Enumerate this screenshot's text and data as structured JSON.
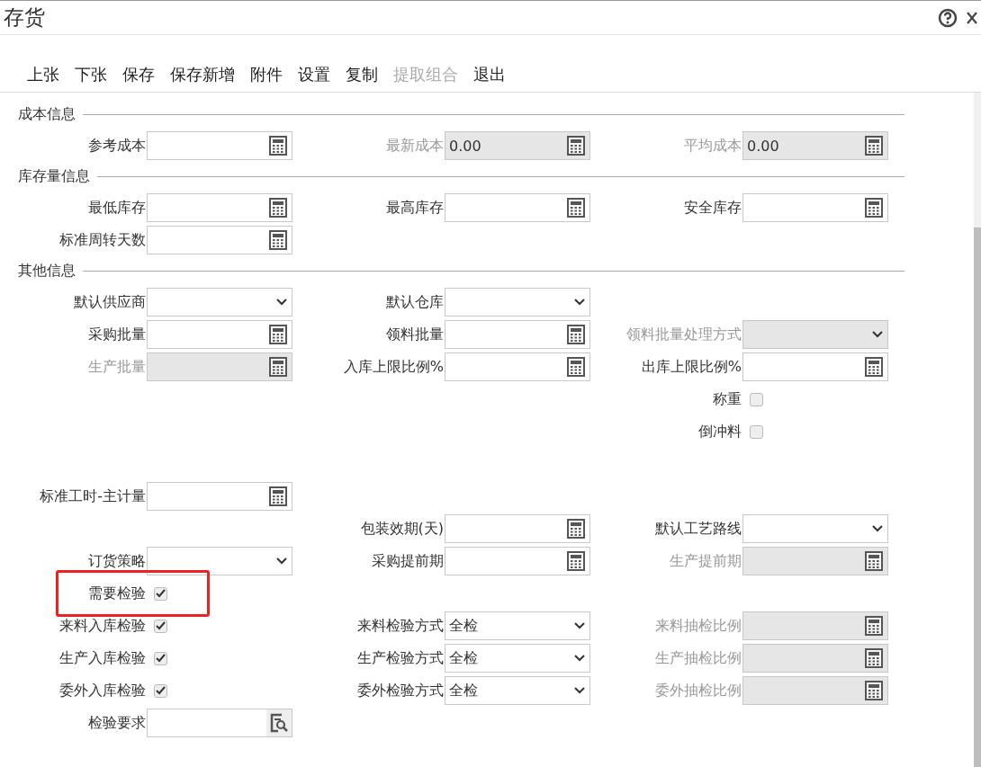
{
  "window": {
    "title": "存货"
  },
  "toolbar": [
    {
      "label": "上张",
      "disabled": false
    },
    {
      "label": "下张",
      "disabled": false
    },
    {
      "label": "保存",
      "disabled": false
    },
    {
      "label": "保存新增",
      "disabled": false
    },
    {
      "label": "附件",
      "disabled": false
    },
    {
      "label": "设置",
      "disabled": false
    },
    {
      "label": "复制",
      "disabled": false
    },
    {
      "label": "提取组合",
      "disabled": true
    },
    {
      "label": "退出",
      "disabled": false
    }
  ],
  "form": [
    {
      "kind": "section",
      "title": "成本信息"
    },
    {
      "kind": "fields",
      "cells": [
        {
          "kind": "calc",
          "label": "参考成本",
          "disabled": false
        },
        {
          "kind": "calc",
          "label": "最新成本",
          "value": "0.00",
          "disabled": true
        },
        {
          "kind": "calc",
          "label": "平均成本",
          "value": "0.00",
          "disabled": true
        }
      ]
    },
    {
      "kind": "section",
      "title": "库存量信息"
    },
    {
      "kind": "fields",
      "cells": [
        {
          "kind": "calc",
          "label": "最低库存",
          "disabled": false
        },
        {
          "kind": "calc",
          "label": "最高库存",
          "disabled": false
        },
        {
          "kind": "calc",
          "label": "安全库存",
          "disabled": false
        }
      ]
    },
    {
      "kind": "fields",
      "cells": [
        {
          "kind": "calc",
          "label": "标准周转天数",
          "disabled": false
        },
        {
          "kind": "empty"
        },
        {
          "kind": "empty"
        }
      ]
    },
    {
      "kind": "section",
      "title": "其他信息"
    },
    {
      "kind": "fields",
      "cells": [
        {
          "kind": "select",
          "label": "默认供应商",
          "disabled": false
        },
        {
          "kind": "select",
          "label": "默认仓库",
          "disabled": false
        },
        {
          "kind": "empty"
        }
      ]
    },
    {
      "kind": "fields",
      "cells": [
        {
          "kind": "calc",
          "label": "采购批量",
          "disabled": false
        },
        {
          "kind": "calc",
          "label": "领料批量",
          "disabled": false
        },
        {
          "kind": "select",
          "label": "领料批量处理方式",
          "disabled": true
        }
      ]
    },
    {
      "kind": "fields",
      "cells": [
        {
          "kind": "calc",
          "label": "生产批量",
          "disabled": true
        },
        {
          "kind": "calc",
          "label": "入库上限比例%",
          "disabled": false
        },
        {
          "kind": "calc",
          "label": "出库上限比例%",
          "disabled": false
        }
      ]
    },
    {
      "kind": "fields",
      "cells": [
        {
          "kind": "empty"
        },
        {
          "kind": "empty"
        },
        {
          "kind": "checkbox",
          "label": "称重",
          "checked": false,
          "highlighted": false
        }
      ]
    },
    {
      "kind": "fields",
      "cells": [
        {
          "kind": "empty"
        },
        {
          "kind": "empty"
        },
        {
          "kind": "checkbox",
          "label": "倒冲料",
          "checked": false,
          "highlighted": false
        }
      ]
    },
    {
      "kind": "blank"
    },
    {
      "kind": "fields",
      "cells": [
        {
          "kind": "calc",
          "label": "标准工时-主计量",
          "disabled": false
        },
        {
          "kind": "empty"
        },
        {
          "kind": "empty"
        }
      ]
    },
    {
      "kind": "fields",
      "cells": [
        {
          "kind": "empty"
        },
        {
          "kind": "calc",
          "label": "包装效期(天)",
          "disabled": false
        },
        {
          "kind": "select",
          "label": "默认工艺路线",
          "disabled": false
        }
      ]
    },
    {
      "kind": "fields",
      "cells": [
        {
          "kind": "select",
          "label": "订货策略",
          "disabled": false
        },
        {
          "kind": "calc",
          "label": "采购提前期",
          "disabled": false
        },
        {
          "kind": "calc",
          "label": "生产提前期",
          "disabled": true
        }
      ]
    },
    {
      "kind": "fields",
      "cells": [
        {
          "kind": "checkbox",
          "label": "需要检验",
          "checked": true,
          "highlighted": true
        },
        {
          "kind": "empty"
        },
        {
          "kind": "empty"
        }
      ]
    },
    {
      "kind": "fields",
      "cells": [
        {
          "kind": "checkbox",
          "label": "来料入库检验",
          "checked": true,
          "highlighted": false
        },
        {
          "kind": "select",
          "label": "来料检验方式",
          "value": "全检",
          "disabled": false
        },
        {
          "kind": "calc",
          "label": "来料抽检比例",
          "disabled": true
        }
      ]
    },
    {
      "kind": "fields",
      "cells": [
        {
          "kind": "checkbox",
          "label": "生产入库检验",
          "checked": true,
          "highlighted": false
        },
        {
          "kind": "select",
          "label": "生产检验方式",
          "value": "全检",
          "disabled": false
        },
        {
          "kind": "calc",
          "label": "生产抽检比例",
          "disabled": true
        }
      ]
    },
    {
      "kind": "fields",
      "cells": [
        {
          "kind": "checkbox",
          "label": "委外入库检验",
          "checked": true,
          "highlighted": false
        },
        {
          "kind": "select",
          "label": "委外检验方式",
          "value": "全检",
          "disabled": false
        },
        {
          "kind": "calc",
          "label": "委外抽检比例",
          "disabled": true
        }
      ]
    },
    {
      "kind": "fields",
      "cells": [
        {
          "kind": "lookup",
          "label": "检验要求",
          "disabled": false
        },
        {
          "kind": "empty"
        },
        {
          "kind": "empty"
        }
      ]
    }
  ]
}
